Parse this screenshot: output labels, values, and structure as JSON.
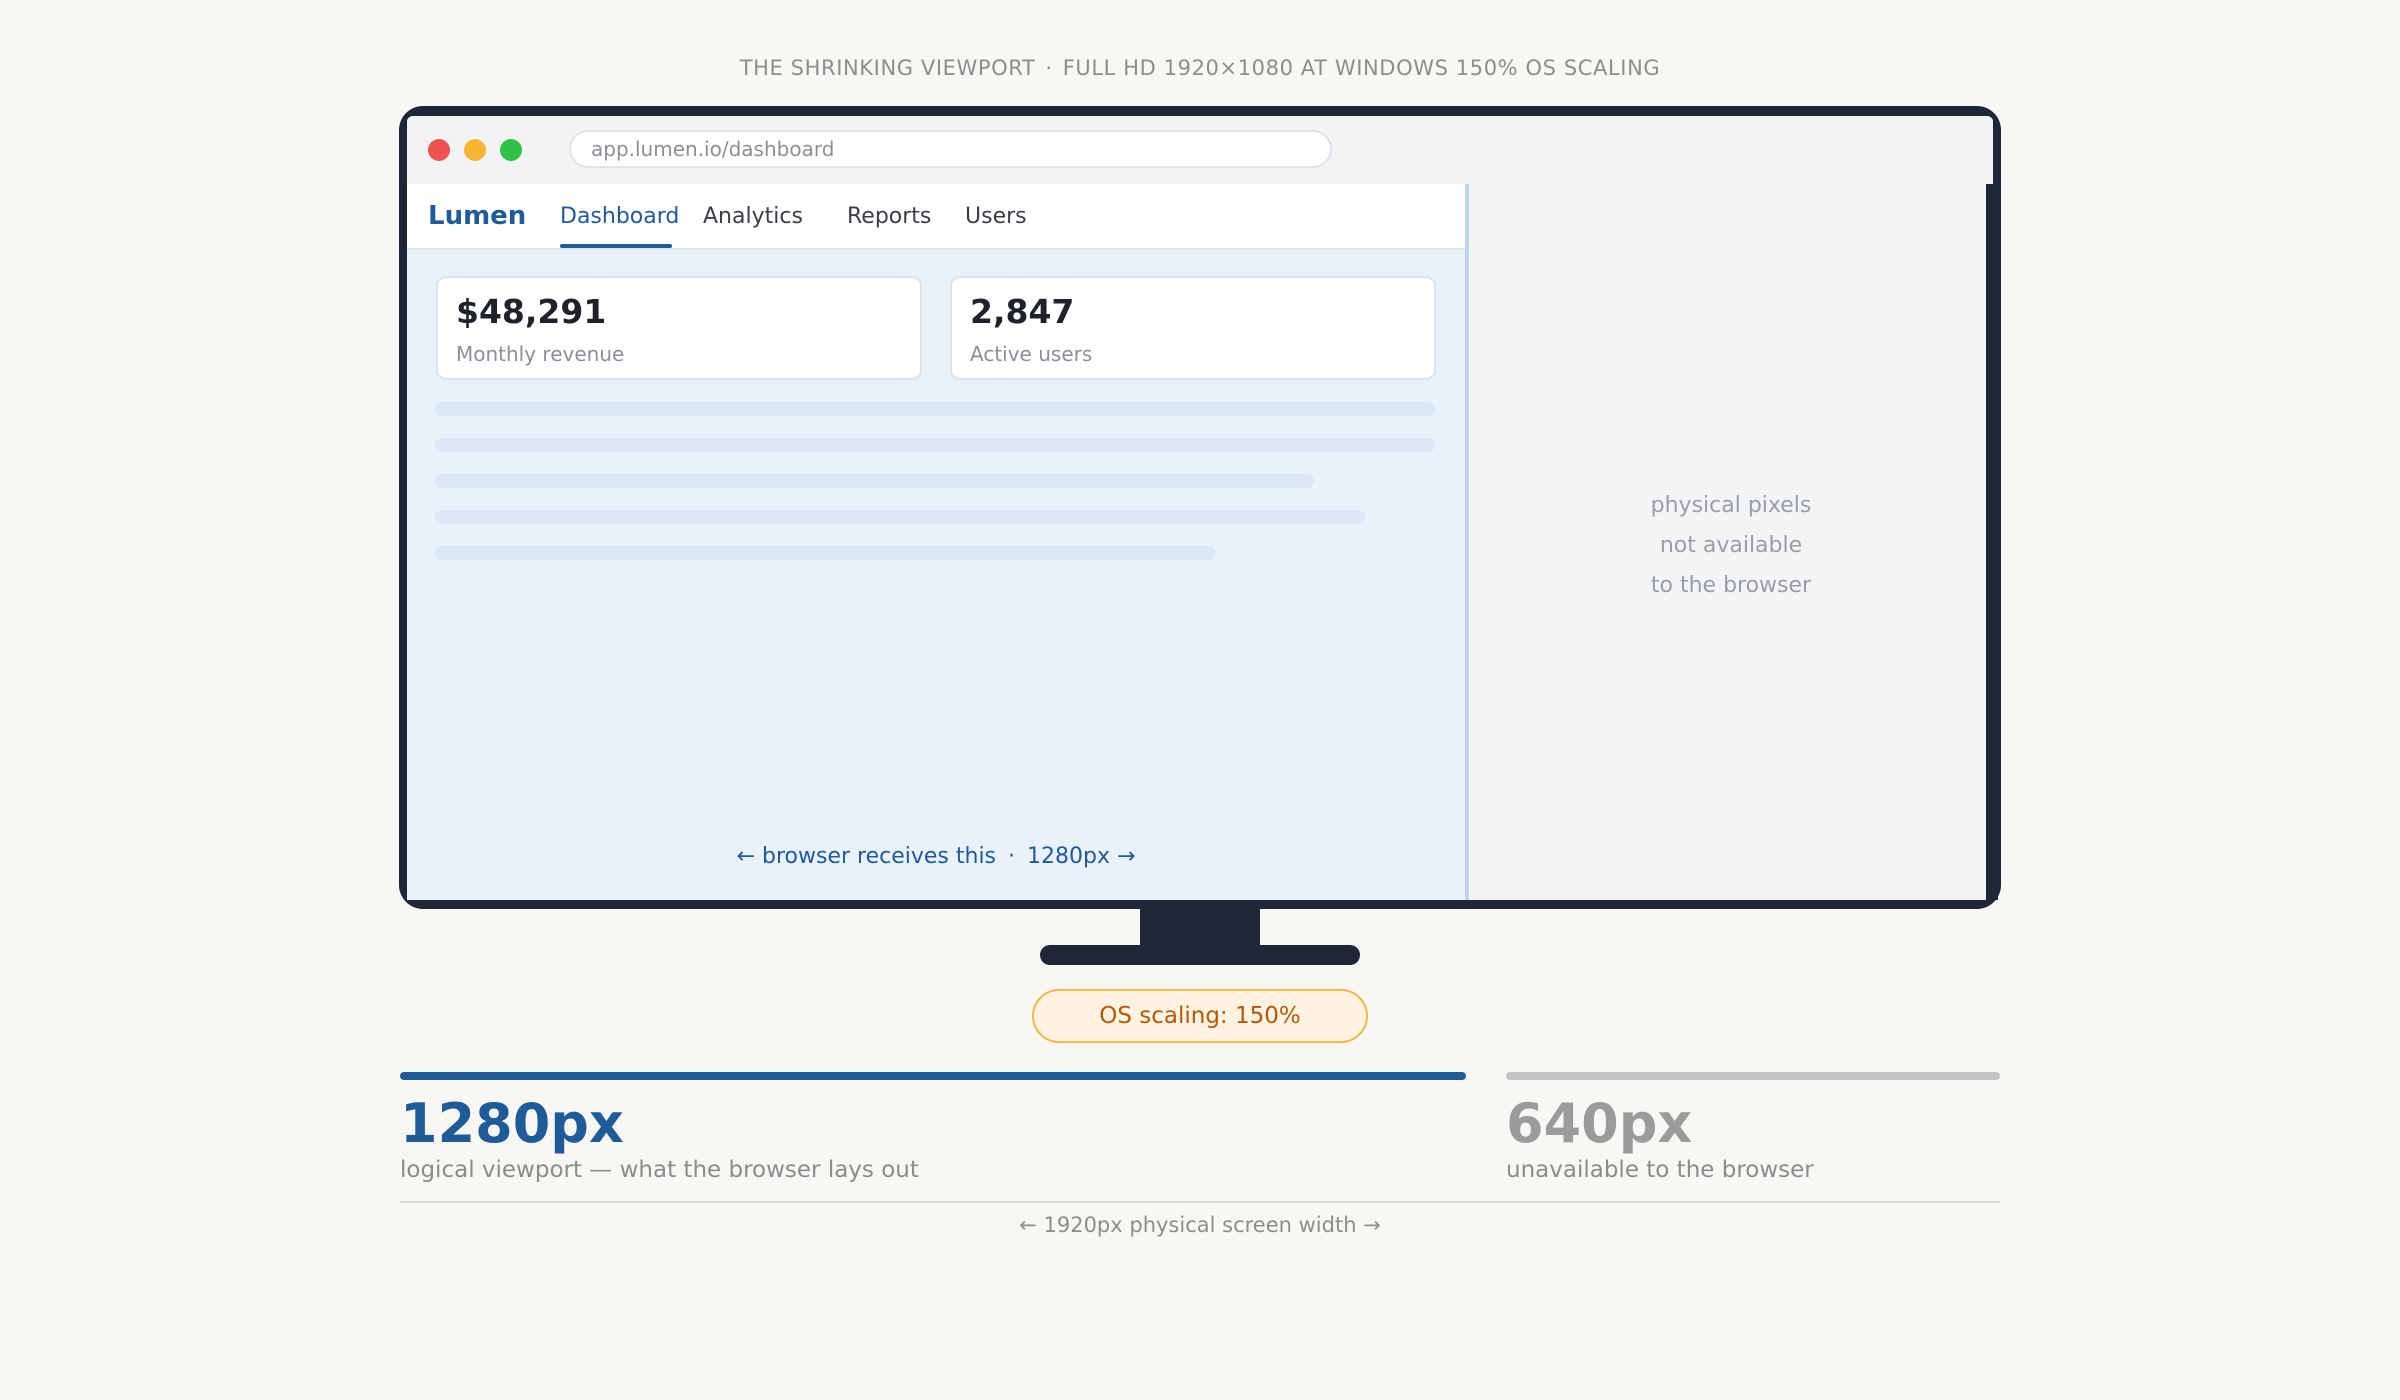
{
  "header": {
    "title": "THE SHRINKING VIEWPORT",
    "separator": "·",
    "subtitle": "FULL HD 1920×1080 AT WINDOWS 150% OS SCALING"
  },
  "browser": {
    "url": "app.lumen.io/dashboard",
    "traffic_colors": [
      "#ef5350",
      "#f5b731",
      "#2fc244"
    ],
    "app": {
      "brand": "Lumen",
      "tabs": [
        "Dashboard",
        "Analytics",
        "Reports",
        "Users"
      ],
      "active_tab": "Dashboard"
    },
    "cards": [
      {
        "value": "$48,291",
        "label": "Monthly revenue"
      },
      {
        "value": "2,847",
        "label": "Active users"
      }
    ],
    "caption": {
      "left": "← browser receives this",
      "separator": "·",
      "right": "1280px →"
    },
    "unavailable": {
      "line1": "physical pixels",
      "line2": "not available",
      "line3": "to the browser"
    }
  },
  "badge": "OS scaling: 150%",
  "legend": {
    "logical": {
      "value": "1280px",
      "label": "logical viewport — what the browser lays out",
      "color": "#1f5a99"
    },
    "unavailable": {
      "value": "640px",
      "label": "unavailable to the browser",
      "color": "#c4c4c4"
    },
    "total": "← 1920px physical screen width →"
  }
}
